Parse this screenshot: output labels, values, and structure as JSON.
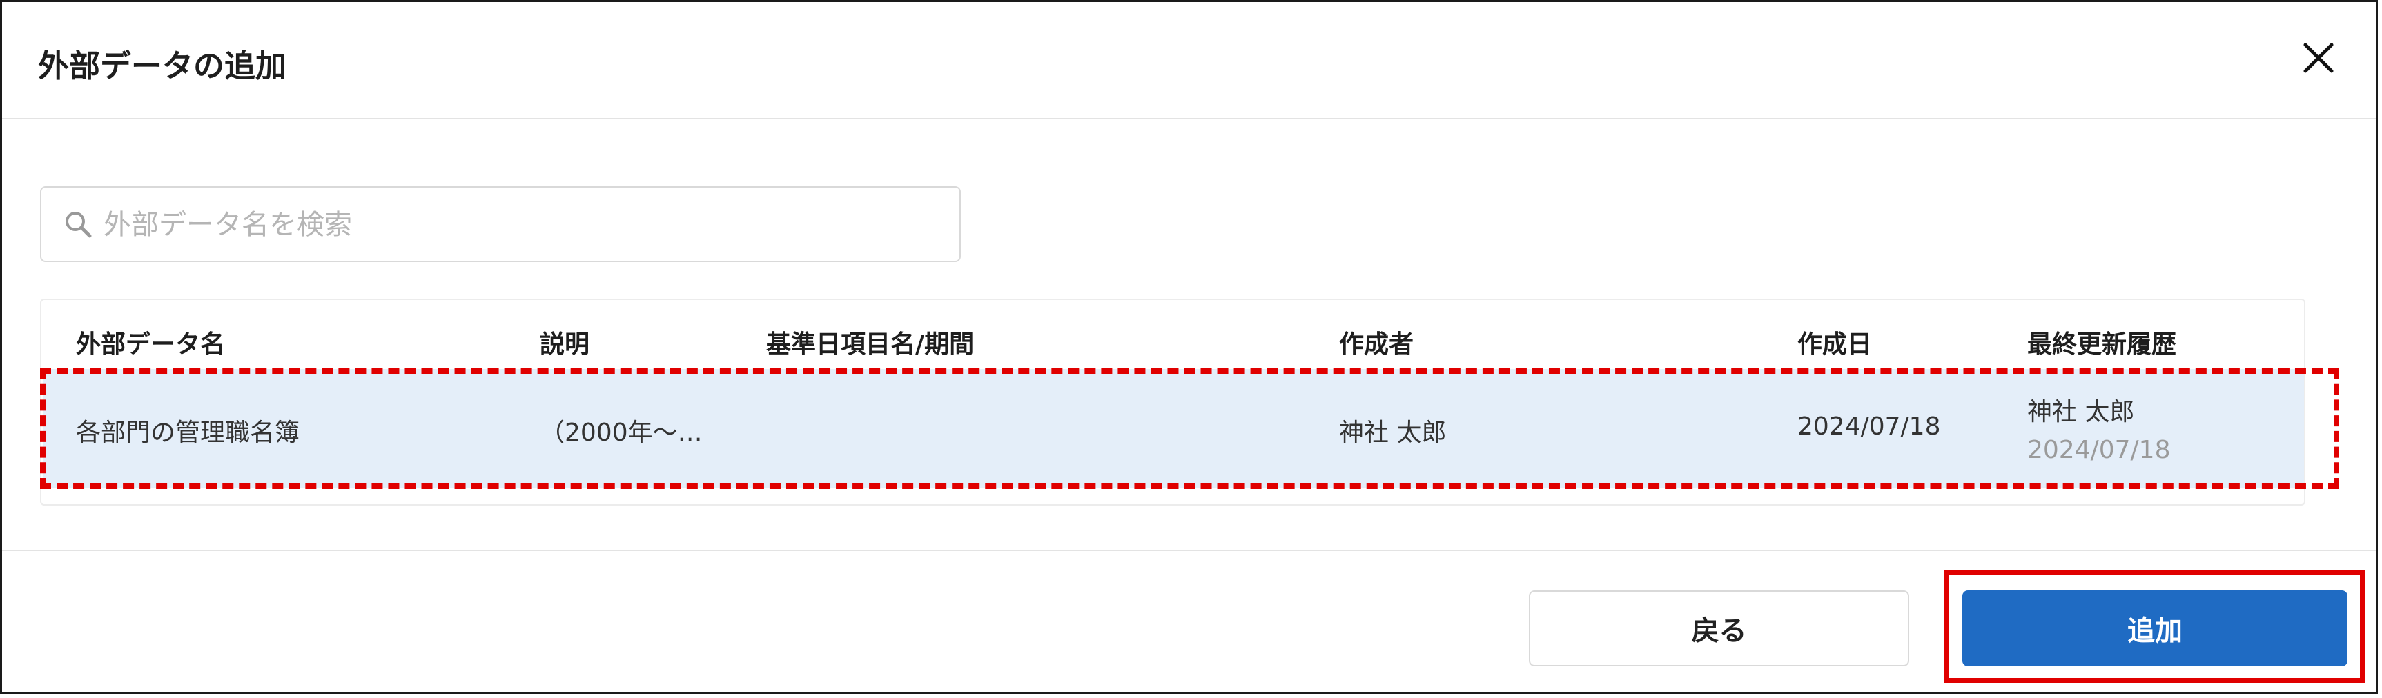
{
  "dialog": {
    "title": "外部データの追加",
    "close_icon": "close-icon"
  },
  "search": {
    "placeholder": "外部データ名を検索",
    "value": "",
    "icon": "search-icon"
  },
  "table": {
    "columns": [
      "外部データ名",
      "説明",
      "基準日項目名/期間",
      "作成者",
      "作成日",
      "最終更新履歴"
    ],
    "rows": [
      {
        "name": "各部門の管理職名簿",
        "description": "（2000年～…",
        "period": "",
        "author": "神社 太郎",
        "created": "2024/07/18",
        "updated_by": "神社 太郎",
        "updated_at": "2024/07/18"
      }
    ]
  },
  "footer": {
    "back_label": "戻る",
    "add_label": "追加"
  },
  "colors": {
    "primary": "#1f6bc3",
    "selected_row": "#e4eef9",
    "annotation": "#e00000"
  }
}
